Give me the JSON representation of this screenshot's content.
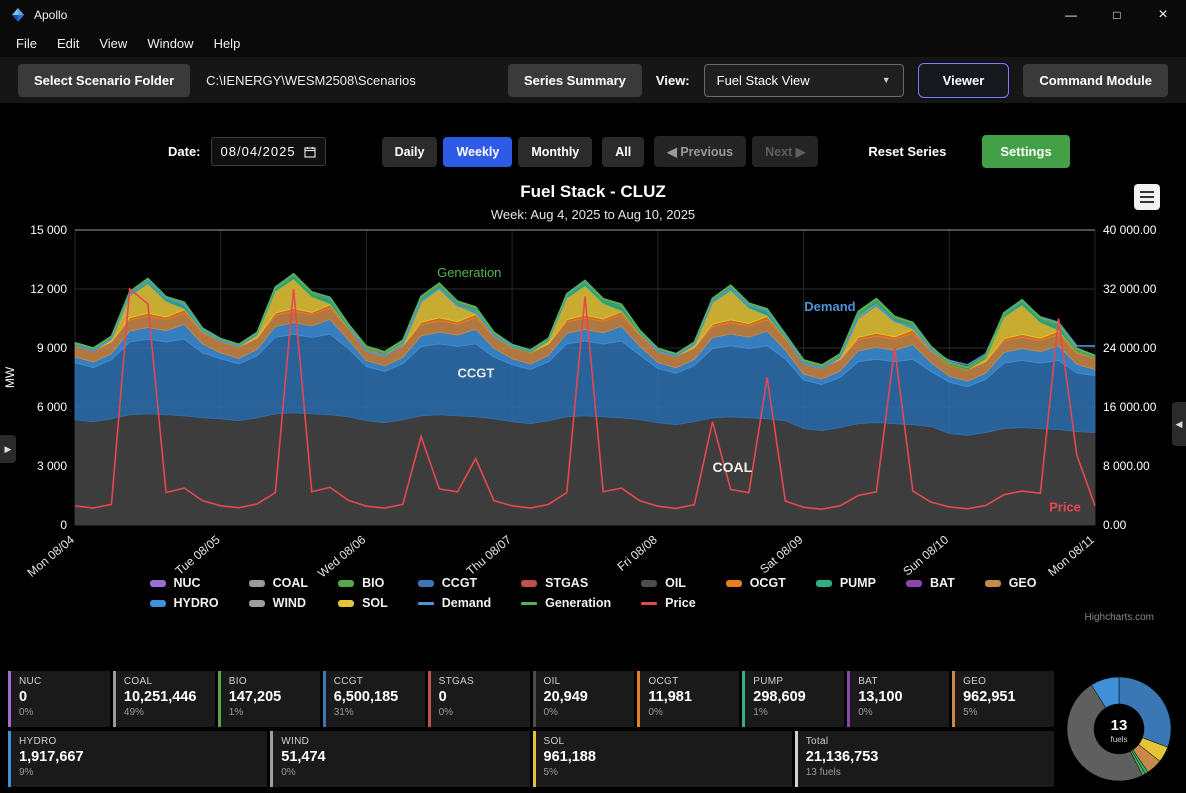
{
  "titlebar": {
    "app_name": "Apollo",
    "controls": {
      "minimize": "—",
      "maximize": "□",
      "close": "×"
    }
  },
  "menubar": {
    "items": [
      "File",
      "Edit",
      "View",
      "Window",
      "Help"
    ]
  },
  "toolbar": {
    "select_scenario_folder": "Select Scenario Folder",
    "scenario_path": "C:\\IENERGY\\WESM2508\\Scenarios",
    "series_summary": "Series Summary",
    "view_label": "View:",
    "view_value": "Fuel Stack View",
    "caret": "▼",
    "viewer": "Viewer",
    "command_module": "Command Module"
  },
  "controls": {
    "date_label": "Date:",
    "date_value": "08/04/2025",
    "daily": "Daily",
    "weekly": "Weekly",
    "monthly": "Monthly",
    "all": "All",
    "previous": "◀ Previous",
    "next": "Next ▶",
    "reset_series": "Reset Series",
    "settings": "Settings"
  },
  "edges": {
    "left": "▶",
    "right": "◀"
  },
  "chart_data": {
    "type": "area",
    "title": "Fuel Stack - CLUZ",
    "subtitle": "Week: Aug 4, 2025 to Aug 10, 2025",
    "credit": "Highcharts.com",
    "points_per_day": 8,
    "x_categories": [
      "Mon 08/04",
      "Tue 08/05",
      "Wed 08/06",
      "Thu 08/07",
      "Fri 08/08",
      "Sat 08/09",
      "Sun 08/10",
      "Mon 08/11"
    ],
    "y_left": {
      "label": "MW",
      "min": 0,
      "max": 15000,
      "ticks": [
        "0",
        "3 000",
        "6 000",
        "9 000",
        "12 000",
        "15 000"
      ]
    },
    "y_right": {
      "label": "",
      "min": 0,
      "max": 40000,
      "ticks": [
        "0.00",
        "8 000.00",
        "16 000.00",
        "24 000.00",
        "32 000.00",
        "40 000.00"
      ]
    },
    "areas": [
      {
        "name": "COAL",
        "color": "#3d3d3d",
        "opacity": 1,
        "values": [
          5350,
          5250,
          5400,
          5600,
          5650,
          5600,
          5550,
          5450,
          5400,
          5300,
          5450,
          5650,
          5700,
          5650,
          5600,
          5500,
          5300,
          5200,
          5350,
          5550,
          5600,
          5550,
          5500,
          5400,
          5250,
          5150,
          5300,
          5500,
          5550,
          5500,
          5450,
          5350,
          5200,
          5100,
          5250,
          5450,
          5500,
          5450,
          5400,
          5300,
          4900,
          4800,
          4950,
          5150,
          5200,
          5150,
          5100,
          5000,
          4650,
          4550,
          4700,
          4900,
          4950,
          4900,
          4850,
          4750,
          4700
        ]
      },
      {
        "name": "CCGT",
        "color": "#2f6fae",
        "values": [
          2900,
          2750,
          3000,
          3700,
          3800,
          3700,
          3900,
          3300,
          3050,
          2890,
          3150,
          3890,
          3990,
          3890,
          4100,
          3470,
          2760,
          2610,
          2850,
          3520,
          3610,
          3520,
          3710,
          3140,
          2900,
          2750,
          3000,
          3700,
          3800,
          3700,
          3900,
          3300,
          2760,
          2610,
          2850,
          3520,
          3610,
          3520,
          3710,
          3140,
          2470,
          2340,
          2550,
          3150,
          3230,
          3150,
          3320,
          2810,
          2610,
          2480,
          2700,
          3330,
          3420,
          3330,
          3510,
          2970,
          2900
        ]
      },
      {
        "name": "HYDRO",
        "color": "#3f8fd9",
        "values": [
          300,
          280,
          320,
          550,
          600,
          580,
          750,
          450
        ]
      },
      {
        "name": "GEO",
        "color": "#c8884a",
        "values": 570
      },
      {
        "name": "OCGT",
        "color": "#e67e22",
        "values": [
          20,
          20,
          30,
          120,
          150,
          120,
          180,
          60
        ]
      },
      {
        "name": "SOL",
        "color": "#e3c438",
        "values": [
          0,
          0,
          150,
          1100,
          1500,
          800,
          50,
          0
        ]
      },
      {
        "name": "PUMP",
        "color": "#2fb086",
        "values": [
          0,
          0,
          0,
          100,
          150,
          120,
          200,
          50
        ]
      },
      {
        "name": "BIO",
        "color": "#57a64a",
        "values": 90
      },
      {
        "name": "WIND",
        "color": "#9aa0a6",
        "values": [
          40,
          35,
          30,
          25,
          20,
          25,
          35,
          40
        ]
      },
      {
        "name": "OIL",
        "color": "#4d4d4d",
        "values": 3
      },
      {
        "name": "BAT",
        "color": "#8e44ad",
        "values": 2
      },
      {
        "name": "NUC",
        "color": "#a06cd5",
        "values": 0
      },
      {
        "name": "STGAS",
        "color": "#c0504d",
        "values": 0
      }
    ],
    "lines": [
      {
        "name": "Demand",
        "color": "#4f93d8",
        "axis": "left",
        "values": [
          9100,
          8850,
          9450,
          11700,
          12400,
          11500,
          11200,
          9900,
          9375,
          9115,
          9735,
          12050,
          12770,
          11845,
          11535,
          10195,
          8825,
          8585,
          9165,
          11350,
          12030,
          11155,
          10865,
          9605,
          9100,
          8850,
          9450,
          11700,
          12400,
          11500,
          11200,
          9900,
          8825,
          8585,
          9165,
          11350,
          12030,
          11155,
          10865,
          9605,
          8190,
          7965,
          8505,
          10530,
          11160,
          10350,
          10080,
          8910,
          8370,
          8140,
          8695,
          10765,
          11410,
          10580,
          10305,
          9110,
          9100
        ]
      },
      {
        "name": "Generation",
        "color": "#52b455",
        "axis": "left",
        "values": "stack_total"
      },
      {
        "name": "Price",
        "color": "#e5484d",
        "axis": "right",
        "values": [
          2600,
          2300,
          2800,
          32000,
          30000,
          4400,
          5000,
          3300,
          2600,
          2350,
          2850,
          4400,
          32000,
          4500,
          5100,
          3350,
          2550,
          2300,
          2800,
          12000,
          4900,
          4500,
          9000,
          3300,
          2600,
          2300,
          2800,
          4400,
          31000,
          4500,
          5000,
          3300,
          2550,
          2250,
          2750,
          14000,
          4800,
          4400,
          20000,
          3250,
          2400,
          2150,
          2600,
          4000,
          4500,
          24000,
          4600,
          3100,
          2450,
          2200,
          2650,
          4100,
          4600,
          4300,
          28000,
          9500,
          2600
        ]
      }
    ],
    "annotations": [
      {
        "text": "Generation",
        "color": "#52b455",
        "fx": 0.355,
        "fy": 0.16,
        "bold": false,
        "size": 13
      },
      {
        "text": "Demand",
        "color": "#4f93d8",
        "fx": 0.715,
        "fy": 0.275,
        "bold": true,
        "size": 13
      },
      {
        "text": "CCGT",
        "color": "#e8e8e8",
        "fx": 0.375,
        "fy": 0.5,
        "bold": true,
        "size": 13
      },
      {
        "text": "COAL",
        "color": "#f0f0f0",
        "fx": 0.625,
        "fy": 0.82,
        "bold": true,
        "size": 14
      },
      {
        "text": "Price",
        "color": "#e5484d",
        "fx": 0.955,
        "fy": 0.955,
        "bold": true,
        "size": 13
      }
    ]
  },
  "legend": {
    "items": [
      {
        "label": "NUC",
        "color": "#a06cd5",
        "type": "area"
      },
      {
        "label": "COAL",
        "color": "#9a9a9a",
        "type": "area"
      },
      {
        "label": "BIO",
        "color": "#57a64a",
        "type": "area"
      },
      {
        "label": "CCGT",
        "color": "#3a77b5",
        "type": "area"
      },
      {
        "label": "STGAS",
        "color": "#c0504d",
        "type": "area"
      },
      {
        "label": "OIL",
        "color": "#4d4d4d",
        "type": "area"
      },
      {
        "label": "OCGT",
        "color": "#e67e22",
        "type": "area"
      },
      {
        "label": "PUMP",
        "color": "#2fb086",
        "type": "area"
      },
      {
        "label": "BAT",
        "color": "#8e44ad",
        "type": "area"
      },
      {
        "label": "GEO",
        "color": "#c8884a",
        "type": "area"
      },
      {
        "label": "HYDRO",
        "color": "#3f8fd9",
        "type": "area"
      },
      {
        "label": "WIND",
        "color": "#9aa0a6",
        "type": "area"
      },
      {
        "label": "SOL",
        "color": "#e3c438",
        "type": "area"
      },
      {
        "label": "Demand",
        "color": "#4f93d8",
        "type": "line"
      },
      {
        "label": "Generation",
        "color": "#52b455",
        "type": "line"
      },
      {
        "label": "Price",
        "color": "#e5484d",
        "type": "line"
      }
    ]
  },
  "stats": {
    "row1": [
      {
        "name": "NUC",
        "value": "0",
        "sub": "0%",
        "color": "#a06cd5"
      },
      {
        "name": "COAL",
        "value": "10,251,446",
        "sub": "49%",
        "color": "#9a9a9a"
      },
      {
        "name": "BIO",
        "value": "147,205",
        "sub": "1%",
        "color": "#57a64a"
      },
      {
        "name": "CCGT",
        "value": "6,500,185",
        "sub": "31%",
        "color": "#3a77b5"
      },
      {
        "name": "STGAS",
        "value": "0",
        "sub": "0%",
        "color": "#c0504d"
      },
      {
        "name": "OIL",
        "value": "20,949",
        "sub": "0%",
        "color": "#4d4d4d"
      },
      {
        "name": "OCGT",
        "value": "11,981",
        "sub": "0%",
        "color": "#e67e22"
      },
      {
        "name": "PUMP",
        "value": "298,609",
        "sub": "1%",
        "color": "#2fb086"
      },
      {
        "name": "BAT",
        "value": "13,100",
        "sub": "0%",
        "color": "#8e44ad"
      },
      {
        "name": "GEO",
        "value": "962,951",
        "sub": "5%",
        "color": "#c8884a"
      }
    ],
    "row2": [
      {
        "name": "HYDRO",
        "value": "1,917,667",
        "sub": "9%",
        "color": "#3f8fd9"
      },
      {
        "name": "WIND",
        "value": "51,474",
        "sub": "0%",
        "color": "#9aa0a6"
      },
      {
        "name": "SOL",
        "value": "961,188",
        "sub": "5%",
        "color": "#e3c438"
      },
      {
        "name": "Total",
        "value": "21,136,753",
        "sub": "13 fuels",
        "color": "#d0d0d0"
      }
    ],
    "pie": {
      "center_number": "13",
      "center_label": "fuels",
      "slices": [
        {
          "name": "CCGT",
          "pct": 31,
          "color": "#3a77b5"
        },
        {
          "name": "SOL",
          "pct": 5,
          "color": "#e3c438"
        },
        {
          "name": "GEO",
          "pct": 5,
          "color": "#c8884a"
        },
        {
          "name": "PUMP",
          "pct": 1,
          "color": "#2fb086"
        },
        {
          "name": "BIO",
          "pct": 1,
          "color": "#57a64a"
        },
        {
          "name": "COAL",
          "pct": 49,
          "color": "#5f5f5f"
        },
        {
          "name": "HYDRO",
          "pct": 9,
          "color": "#3f8fd9"
        }
      ]
    }
  }
}
